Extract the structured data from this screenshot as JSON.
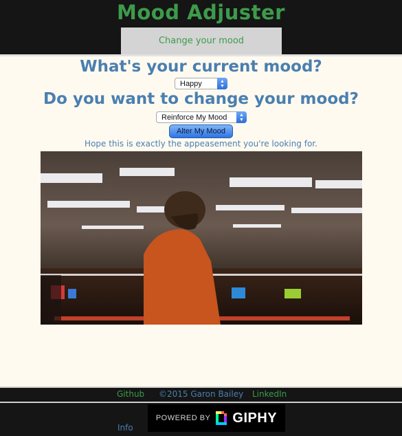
{
  "header": {
    "brand": "Mood Adjuster",
    "tab_label": "Change your mood"
  },
  "main": {
    "question_current": "What's your current mood?",
    "current_mood_selected": "Happy",
    "question_change": "Do you want to change your mood?",
    "change_option_selected": "Reinforce My Mood",
    "alter_button": "Alter My Mood",
    "message": "Hope this is exactly the appeasement you're looking for."
  },
  "gif": {
    "icon": "bowling-alley-scene-image"
  },
  "footer": {
    "github": "Github",
    "copyright": "©2015 Garon Bailey",
    "linkedin": "LinkedIn",
    "info": "Info",
    "powered_by": "POWERED BY",
    "giphy_word": "GIPHY"
  },
  "colors": {
    "green": "#3d9b4b",
    "blue": "#4a7fb0",
    "dark": "#151515",
    "cream": "#fffaf0"
  }
}
